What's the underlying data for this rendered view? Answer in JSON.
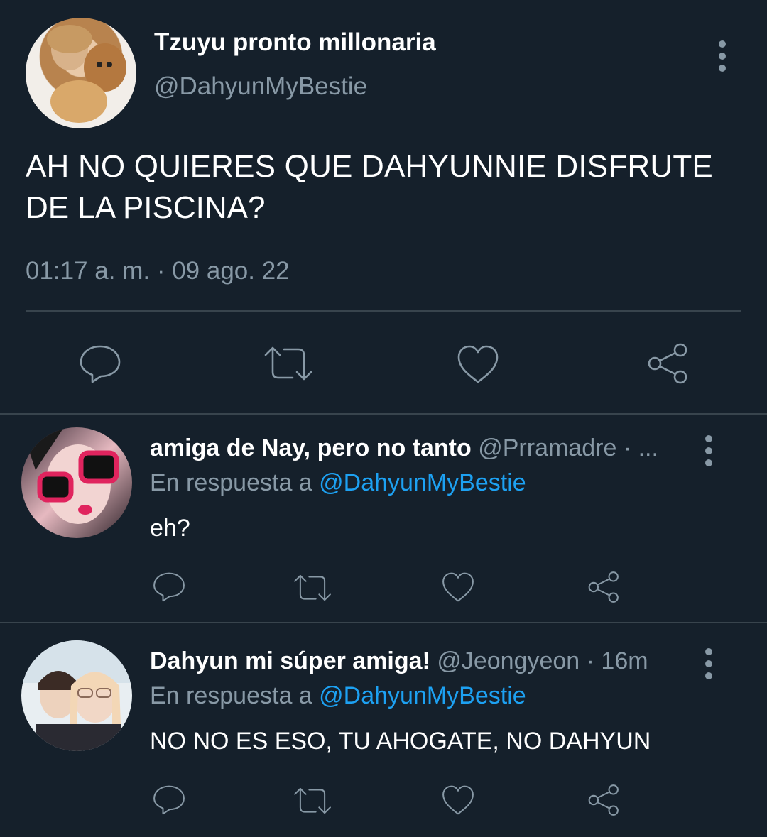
{
  "main_tweet": {
    "display_name": "Tzuyu pronto millonaria",
    "handle": "@DahyunMyBestie",
    "text_line1": "AH NO QUIERES QUE DAHYUNNIE DISFRUTE",
    "text_line2": "DE LA PISCINA?",
    "timestamp": "01:17 a. m. · 09 ago. 22"
  },
  "replies": [
    {
      "display_name": "amiga de Nay, pero no tanto",
      "handle": "@Prramadre · ...",
      "reply_to_prefix": "En respuesta a",
      "reply_to_handle": "@DahyunMyBestie",
      "text": "eh?"
    },
    {
      "display_name": "Dahyun mi súper amiga!",
      "handle": "@Jeongyeon · 16m",
      "reply_to_prefix": "En respuesta a",
      "reply_to_handle": "@DahyunMyBestie",
      "text": "NO NO ES ESO, TU AHOGATE, NO DAHYUN"
    }
  ],
  "icons": [
    "reply-icon",
    "retweet-icon",
    "like-icon",
    "share-icon",
    "more-options-icon"
  ],
  "colors": {
    "background": "#15202b",
    "text": "#ffffff",
    "muted": "#8899a6",
    "link": "#1da1f2",
    "divider": "#38444d"
  }
}
